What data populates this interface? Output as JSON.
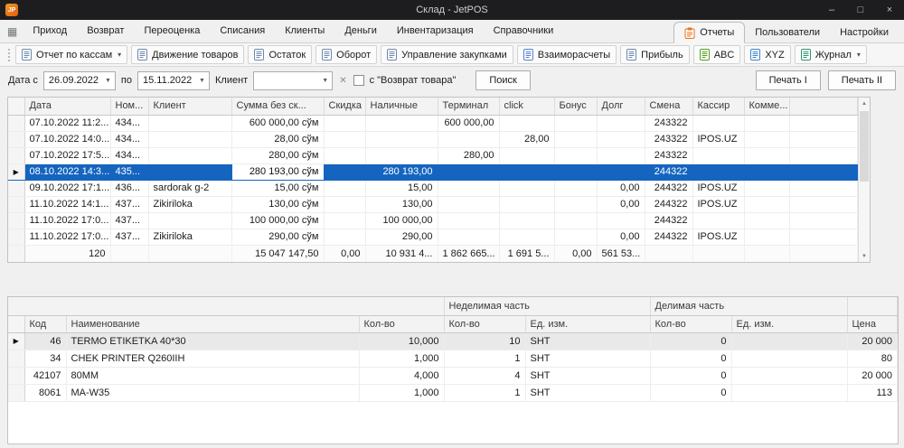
{
  "colors": {
    "selection_blue": "#1565c0",
    "titlebar_bg": "#1d1d20",
    "accent_orange": "#e8731a"
  },
  "window": {
    "logo_text": "JP",
    "title": "Склад - JetPOS",
    "minimize": "–",
    "maximize": "□",
    "close": "×"
  },
  "menu": {
    "grid_icon": "▦",
    "left": [
      "Приход",
      "Возврат",
      "Переоценка",
      "Списания",
      "Клиенты",
      "Деньги",
      "Инвентаризация",
      "Справочники"
    ],
    "right": [
      {
        "id": "reports",
        "label": "Отчеты",
        "active": true,
        "icon": "reports-clipboard-icon"
      },
      {
        "id": "users",
        "label": "Пользователи",
        "active": false
      },
      {
        "id": "settings",
        "label": "Настройки",
        "active": false
      }
    ]
  },
  "toolbar": {
    "buttons": [
      {
        "id": "cash-reports",
        "label": "Отчет по кассам",
        "dropdown": true,
        "icon": "cash-report-icon",
        "icon_color": "#6e89ab"
      },
      {
        "id": "goods-movement",
        "label": "Движение товаров",
        "dropdown": false,
        "icon": "goods-movement-icon",
        "icon_color": "#6e89ab"
      },
      {
        "id": "stock",
        "label": "Остаток",
        "dropdown": false,
        "icon": "stock-icon",
        "icon_color": "#6e89ab"
      },
      {
        "id": "turnover",
        "label": "Оборот",
        "dropdown": false,
        "icon": "turnover-icon",
        "icon_color": "#6e89ab"
      },
      {
        "id": "purchase-management",
        "label": "Управление закупками",
        "dropdown": false,
        "icon": "purchase-management-icon",
        "icon_color": "#6e89ab"
      },
      {
        "id": "settlements",
        "label": "Взаиморасчеты",
        "dropdown": false,
        "icon": "settlements-icon",
        "icon_color": "#5b7fd4"
      },
      {
        "id": "profit",
        "label": "Прибыль",
        "dropdown": false,
        "icon": "profit-icon",
        "icon_color": "#6e89ab"
      },
      {
        "id": "abc",
        "label": "ABC",
        "dropdown": false,
        "icon": "abc-report-icon",
        "icon_color": "#53a11d"
      },
      {
        "id": "xyz",
        "label": "XYZ",
        "dropdown": false,
        "icon": "xyz-report-icon",
        "icon_color": "#3a86c8"
      },
      {
        "id": "journal",
        "label": "Журнал",
        "dropdown": true,
        "icon": "journal-icon",
        "icon_color": "#2e9373"
      }
    ]
  },
  "filters": {
    "date_from_label": "Дата с",
    "date_from_value": "26.09.2022",
    "date_to_label": "по",
    "date_to_value": "15.11.2022",
    "client_label": "Клиент",
    "client_value": "",
    "clear_icon": "✕",
    "return_label": "с \"Возврат товара\"",
    "return_checked": false,
    "search_button": "Поиск",
    "print1": "Печать I",
    "print2": "Печать II"
  },
  "sales_grid": {
    "columns": [
      "Дата",
      "Ном...",
      "Клиент",
      "Сумма без ск...",
      "Скидка",
      "Наличные",
      "Терминал",
      "click",
      "Бонус",
      "Долг",
      "Смена",
      "Кассир",
      "Комме..."
    ],
    "rows": [
      {
        "selected": false,
        "cells": [
          "07.10.2022 11:2...",
          "434...",
          "",
          "600 000,00 сўм",
          "",
          "",
          "600 000,00",
          "",
          "",
          "",
          "243322",
          "",
          ""
        ]
      },
      {
        "selected": false,
        "cells": [
          "07.10.2022 14:0...",
          "434...",
          "",
          "28,00 сўм",
          "",
          "",
          "",
          "28,00",
          "",
          "",
          "243322",
          "IPOS.UZ",
          ""
        ]
      },
      {
        "selected": false,
        "cells": [
          "07.10.2022 17:5...",
          "434...",
          "",
          "280,00 сўм",
          "",
          "",
          "280,00",
          "",
          "",
          "",
          "243322",
          "",
          ""
        ]
      },
      {
        "selected": true,
        "focused_cell": 3,
        "cells": [
          "08.10.2022 14:3...",
          "435...",
          "",
          "280 193,00 сўм",
          "",
          "280 193,00",
          "",
          "",
          "",
          "",
          "244322",
          "",
          ""
        ]
      },
      {
        "selected": false,
        "cells": [
          "09.10.2022 17:1...",
          "436...",
          "sardorak g-2",
          "15,00 сўм",
          "",
          "15,00",
          "",
          "",
          "",
          "0,00",
          "244322",
          "IPOS.UZ",
          ""
        ]
      },
      {
        "selected": false,
        "cells": [
          "11.10.2022 14:1...",
          "437...",
          "Zikiriloka",
          "130,00 сўм",
          "",
          "130,00",
          "",
          "",
          "",
          "0,00",
          "244322",
          "IPOS.UZ",
          ""
        ]
      },
      {
        "selected": false,
        "cells": [
          "11.10.2022 17:0...",
          "437...",
          "",
          "100 000,00 сўм",
          "",
          "100 000,00",
          "",
          "",
          "",
          "",
          "244322",
          "",
          ""
        ]
      },
      {
        "selected": false,
        "cells": [
          "11.10.2022 17:0...",
          "437...",
          "Zikiriloka",
          "290,00 сўм",
          "",
          "290,00",
          "",
          "",
          "",
          "0,00",
          "244322",
          "IPOS.UZ",
          ""
        ]
      }
    ],
    "summary": [
      "120",
      "",
      "",
      "15 047 147,50",
      "0,00",
      "10 931 4...",
      "1 862 665...",
      "1 691 5...",
      "0,00",
      "561 53...",
      "",
      "",
      ""
    ]
  },
  "items_grid": {
    "group_headers": [
      {
        "label": "",
        "span": 4
      },
      {
        "label": "Неделимая часть",
        "span": 2
      },
      {
        "label": "Делимая часть",
        "span": 2
      },
      {
        "label": "",
        "span": 1
      }
    ],
    "columns": [
      "Код",
      "Наименование",
      "Кол-во",
      "Кол-во",
      "Ед. изм.",
      "Кол-во",
      "Ед. изм.",
      "Цена"
    ],
    "rows": [
      {
        "selected": true,
        "cells": [
          "46",
          "TERMO ETIKETKA 40*30",
          "10,000",
          "10",
          "SHT",
          "0",
          "",
          "20 000"
        ]
      },
      {
        "selected": false,
        "cells": [
          "34",
          "CHEK PRINTER Q260IIH",
          "1,000",
          "1",
          "SHT",
          "0",
          "",
          "80"
        ]
      },
      {
        "selected": false,
        "cells": [
          "42107",
          "80MM",
          "4,000",
          "4",
          "SHT",
          "0",
          "",
          "20 000"
        ]
      },
      {
        "selected": false,
        "cells": [
          "8061",
          "MA-W35",
          "1,000",
          "1",
          "SHT",
          "0",
          "",
          "113"
        ]
      }
    ]
  }
}
